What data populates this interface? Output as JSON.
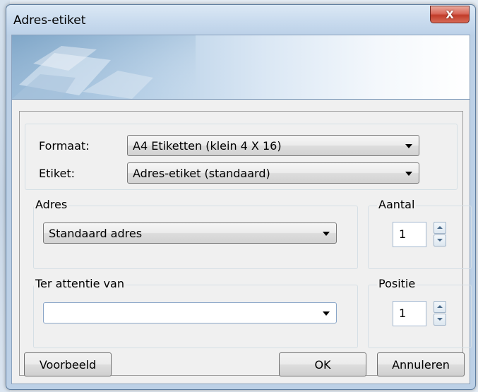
{
  "window": {
    "title": "Adres-etiket",
    "close_glyph": "X",
    "close_icon": "close-icon"
  },
  "format_group": {
    "formaat_label": "Formaat:",
    "formaat_value": "A4 Etiketten (klein 4 X 16)",
    "etiket_label": "Etiket:",
    "etiket_value": "Adres-etiket (standaard)"
  },
  "adres_group": {
    "label": "Adres",
    "value": "Standaard adres"
  },
  "aantal_group": {
    "label": "Aantal",
    "value": "1"
  },
  "attentie_group": {
    "label": "Ter attentie van",
    "value": ""
  },
  "positie_group": {
    "label": "Positie",
    "value": "1"
  },
  "buttons": {
    "preview": "Voorbeeld",
    "ok": "OK",
    "cancel": "Annuleren"
  },
  "colors": {
    "dialog_frame": "#bcd0e6",
    "close_button": "#c13c2a",
    "client_bg": "#f0f0f0"
  }
}
